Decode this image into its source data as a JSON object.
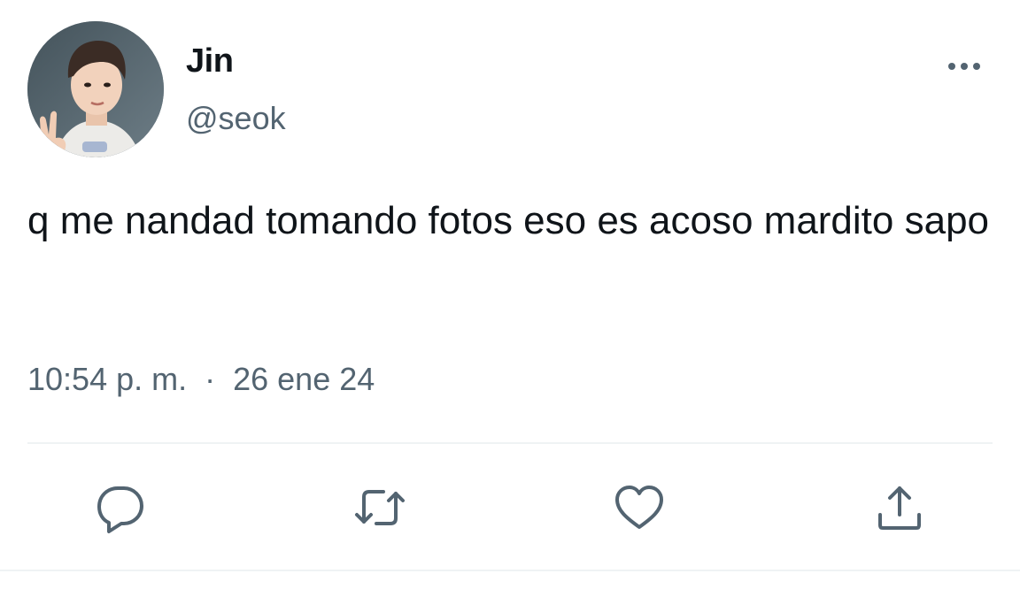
{
  "tweet": {
    "author_name": "Jin",
    "author_handle": "@seok",
    "text": "q me nandad tomando fotos eso es acoso mardito sapo",
    "time": "10:54 p. m.",
    "separator": "·",
    "date": "26 ene 24"
  },
  "icons": {
    "more": "more-horizontal-icon",
    "reply": "reply-bubble-icon",
    "retweet": "retweet-icon",
    "like": "heart-icon",
    "share": "share-upload-icon"
  },
  "colors": {
    "text_primary": "#0f1419",
    "text_secondary": "#536471",
    "divider": "#eff3f4"
  }
}
